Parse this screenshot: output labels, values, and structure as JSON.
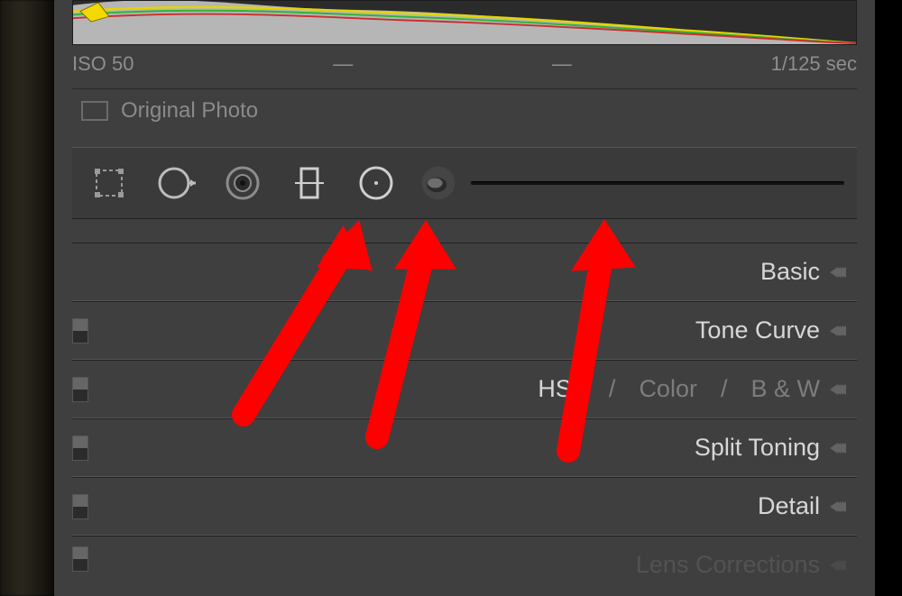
{
  "histogram": {
    "iso": "ISO 50",
    "aperture": "—",
    "focal": "—",
    "shutter": "1/125 sec"
  },
  "original": {
    "label": "Original Photo"
  },
  "tools": {
    "crop": "crop-icon",
    "spot": "spot-removal-icon",
    "redeye": "red-eye-icon",
    "graduated": "graduated-filter-icon",
    "radial": "radial-filter-icon",
    "brush": "adjustment-brush-icon"
  },
  "panels": {
    "basic": "Basic",
    "tonecurve": "Tone Curve",
    "hsl": "HSL",
    "color": "Color",
    "bw": "B & W",
    "split": "Split Toning",
    "detail": "Detail",
    "lens": "Lens Corrections"
  },
  "separators": {
    "slash": "/"
  }
}
